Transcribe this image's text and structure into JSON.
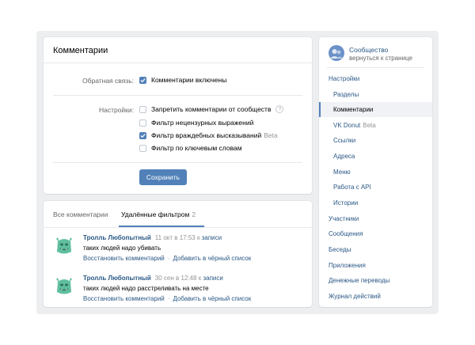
{
  "settings": {
    "title": "Комментарии",
    "feedback_label": "Обратная связь:",
    "feedback_option": "Комментарии включены",
    "settings_label": "Настройки:",
    "options": [
      {
        "label": "Запретить комментарии от сообществ",
        "checked": false,
        "suffix": "",
        "help": "?"
      },
      {
        "label": "Фильтр нецензурных выражений",
        "checked": false,
        "suffix": ""
      },
      {
        "label": "Фильтр враждебных высказываний",
        "checked": true,
        "suffix": "Beta"
      },
      {
        "label": "Фильтр по ключевым словам",
        "checked": false,
        "suffix": ""
      }
    ],
    "save_label": "Сохранить"
  },
  "comments_panel": {
    "tabs": [
      {
        "label": "Все комментарии"
      },
      {
        "label": "Удалённые фильтром",
        "count": "2"
      }
    ],
    "items": [
      {
        "author": "Тролль Любопытный",
        "date": "11 окт в 17:53 к",
        "post_link": "записи",
        "text": "таких людей надо убивать",
        "restore": "Восстановить комментарий",
        "blacklist": "Добавить в чёрный список",
        "sep": "·"
      },
      {
        "author": "Тролль Любопытный",
        "date": "30 сен в 12:48 к",
        "post_link": "записи",
        "text": "таких людей надо расстреливать на месте",
        "restore": "Восстановить комментарий",
        "blacklist": "Добавить в чёрный список",
        "sep": "·"
      }
    ]
  },
  "sidebar": {
    "group_name": "Сообщество",
    "back_link": "вернуться к странице",
    "items": [
      {
        "label": "Настройки"
      },
      {
        "label": "Разделы"
      },
      {
        "label": "Комментарии"
      },
      {
        "label": "VK Donut",
        "beta": "Beta"
      },
      {
        "label": "Ссылки"
      },
      {
        "label": "Адреса"
      },
      {
        "label": "Меню"
      },
      {
        "label": "Работа с API"
      },
      {
        "label": "Истории"
      },
      {
        "label": "Участники"
      },
      {
        "label": "Сообщения"
      },
      {
        "label": "Беседы"
      },
      {
        "label": "Приложения"
      },
      {
        "label": "Денежные переводы"
      },
      {
        "label": "Журнал действий"
      }
    ]
  },
  "colors": {
    "accent": "#5181b8",
    "link": "#2a5885",
    "background": "#edeef0",
    "avatar": "#5fbf9f"
  }
}
